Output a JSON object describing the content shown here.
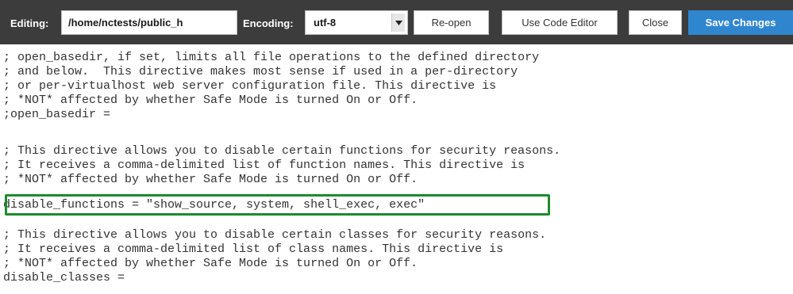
{
  "toolbar": {
    "editing_label": "Editing:",
    "file_path": "/home/nctests/public_h",
    "encoding_label": "Encoding:",
    "encoding_value": "utf-8",
    "reopen_label": "Re-open",
    "code_editor_label": "Use Code Editor",
    "close_label": "Close",
    "save_label": "Save Changes",
    "save_color": "#2f86cf"
  },
  "editor": {
    "highlight_color": "#1f8a2e",
    "highlighted_line": "disable_functions = \"show_source, system, shell_exec, exec\"",
    "lines": [
      "; open_basedir, if set, limits all file operations to the defined directory",
      "; and below.  This directive makes most sense if used in a per-directory",
      "; or per-virtualhost web server configuration file. This directive is",
      "; *NOT* affected by whether Safe Mode is turned On or Off.",
      ";open_basedir =",
      "; This directive allows you to disable certain functions for security reasons.",
      "; It receives a comma-delimited list of function names. This directive is",
      "; *NOT* affected by whether Safe Mode is turned On or Off.",
      "disable_functions = \"show_source, system, shell_exec, exec\"",
      "; This directive allows you to disable certain classes for security reasons.",
      "; It receives a comma-delimited list of class names. This directive is",
      "; *NOT* affected by whether Safe Mode is turned On or Off.",
      "disable_classes ="
    ]
  }
}
